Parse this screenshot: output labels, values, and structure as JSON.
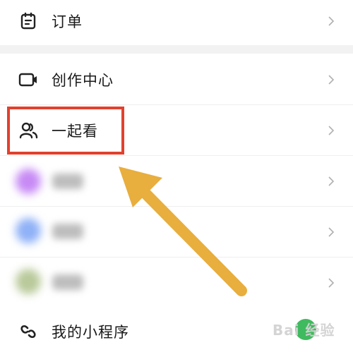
{
  "menu": {
    "orders": {
      "label": "订单",
      "icon": "clipboard-icon"
    },
    "creator_center": {
      "label": "创作中心",
      "icon": "camera-icon"
    },
    "watch_together": {
      "label": "一起看",
      "icon": "users-icon"
    },
    "mini_programs": {
      "label": "我的小程序",
      "icon": "link-icon"
    }
  },
  "colors": {
    "highlight_border": "#e2412e",
    "arrow": "#e8ae3e",
    "divider": "#efefef",
    "section_gap": "#f2f2f2",
    "blur_purple": "#c78af5",
    "blur_blue": "#8fb1f7",
    "blur_green": "#b9c99a"
  },
  "watermark": {
    "text": "Bai 经验"
  }
}
